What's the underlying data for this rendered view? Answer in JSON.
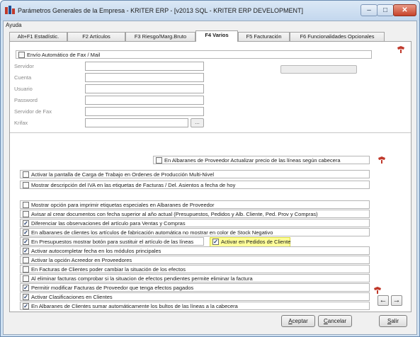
{
  "window": {
    "title": "Parámetros Generales de la Empresa - KRITER ERP - [v2013 SQL - KRITER ERP DEVELOPMENT]",
    "min_glyph": "–",
    "max_glyph": "□",
    "close_glyph": "✕"
  },
  "menu": {
    "help": "Ayuda"
  },
  "tabs": [
    {
      "label": "Alt+F1 Estadístic."
    },
    {
      "label": "F2 Artículos"
    },
    {
      "label": "F3 Riesgo/Marg.Bruto"
    },
    {
      "label": "F4 Varios",
      "active": true
    },
    {
      "label": "F5 Facturación"
    },
    {
      "label": "F6 Funcionalidades Opcionales"
    }
  ],
  "fax_section": {
    "toggle_label": "Envío Automático de Fax / Mail",
    "fields": [
      {
        "label": "Servidor",
        "value": ""
      },
      {
        "label": "Cuenta",
        "value": ""
      },
      {
        "label": "Usuario",
        "value": ""
      },
      {
        "label": "Password",
        "value": ""
      },
      {
        "label": "Servidor de Fax",
        "value": ""
      },
      {
        "label": "Krifax",
        "value": ""
      }
    ],
    "browse_label": "..."
  },
  "albaranes_proveedor": {
    "label": "En Albaranes de Proveedor Actualizar precio de las líneas según cabecera",
    "checked": false
  },
  "options_group1": [
    {
      "label": "Activar la pantalla de Carga de Trabajo en Ordenes de Producción Multi-Nivel",
      "checked": false
    },
    {
      "label": "Mostrar descripción del IVA en las etiquetas de Facturas / Del. Asientos a fecha de hoy",
      "checked": false
    }
  ],
  "options_group2": [
    {
      "label": "Mostrar opción para imprimir etiquetas especiales en Albaranes de Proveedor",
      "checked": false
    },
    {
      "label": "Avisar al crear documentos con fecha superior al año actual (Presupuestos, Pedidos y  Alb. Cliente, Ped. Prov y Compras)",
      "checked": false
    },
    {
      "label": "Diferenciar las observaciones del artículo para Ventas y Compras",
      "checked": true
    },
    {
      "label": "En albaranes de clientes los artículos de fabricación automática no mostrar en color de Stock Negativo",
      "checked": true
    },
    {
      "label": "En Presupuestos mostrar botón para sustituir el artículo de las líneas",
      "checked": true
    },
    {
      "label": "Activar autocompletar fecha en los módulos principales",
      "checked": true
    },
    {
      "label": "Activar la opción Acreedor en Proveedores",
      "checked": false
    },
    {
      "label": "En Facturas de Clientes poder cambiar la situación de los efectos",
      "checked": false
    },
    {
      "label": "Al eliminar facturas comprobar si la situacion de efectos pendientes permite eliminar la factura",
      "checked": false
    },
    {
      "label": "Permitir modificar Facturas de Proveedor que tenga efectos pagados",
      "checked": true
    },
    {
      "label": "Activar Clasificaciones en Clientes",
      "checked": true
    },
    {
      "label": "En Albaranes de Clientes sumar automáticamente los bultos de las líneas a la cabecera",
      "checked": true
    }
  ],
  "pedidos_cliente": {
    "label": "Activar en Pedidos de Cliente",
    "checked": true
  },
  "checked_glyph": "✓",
  "nav": {
    "prev": "←",
    "next": "→"
  },
  "buttons": {
    "accept_first": "A",
    "accept_rest": "ceptar",
    "cancel_first": "C",
    "cancel_rest": "ancelar",
    "exit_first": "S",
    "exit_rest": "alir"
  },
  "colors": {
    "highlight": "#ffff99",
    "window_frame": "#cfe1f2",
    "close_button": "#c6412a"
  }
}
